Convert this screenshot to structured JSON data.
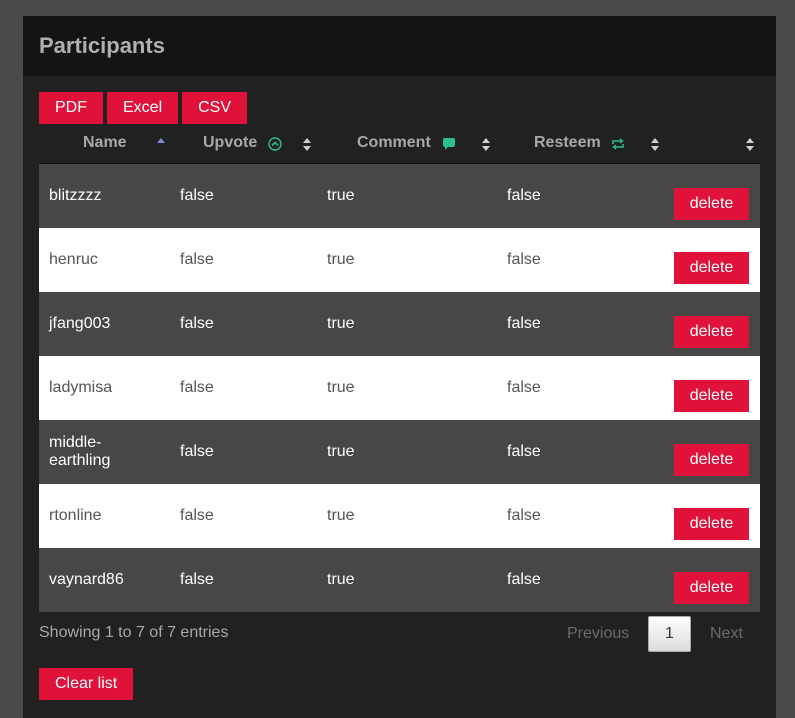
{
  "panel": {
    "title": "Participants"
  },
  "exports": [
    {
      "label": "PDF"
    },
    {
      "label": "Excel"
    },
    {
      "label": "CSV"
    }
  ],
  "columns": {
    "name": "Name",
    "upvote": "Upvote",
    "comment": "Comment",
    "resteem": "Resteem"
  },
  "icons": {
    "upvote": "upvote-circle-icon",
    "comment": "comment-bubble-icon",
    "resteem": "resteem-arrows-icon",
    "accent": "#2bbf8e"
  },
  "rows": [
    {
      "name": "blitzzzz",
      "upvote": "false",
      "comment": "true",
      "resteem": "false",
      "action": "delete"
    },
    {
      "name": "henruc",
      "upvote": "false",
      "comment": "true",
      "resteem": "false",
      "action": "delete"
    },
    {
      "name": "jfang003",
      "upvote": "false",
      "comment": "true",
      "resteem": "false",
      "action": "delete"
    },
    {
      "name": "ladymisa",
      "upvote": "false",
      "comment": "true",
      "resteem": "false",
      "action": "delete"
    },
    {
      "name": "middle-earthling",
      "upvote": "false",
      "comment": "true",
      "resteem": "false",
      "action": "delete"
    },
    {
      "name": "rtonline",
      "upvote": "false",
      "comment": "true",
      "resteem": "false",
      "action": "delete"
    },
    {
      "name": "vaynard86",
      "upvote": "false",
      "comment": "true",
      "resteem": "false",
      "action": "delete"
    }
  ],
  "footer": {
    "info": "Showing 1 to 7 of 7 entries",
    "previous": "Previous",
    "current_page": "1",
    "next": "Next"
  },
  "clear_label": "Clear list",
  "colors": {
    "accent": "#e0123a",
    "row_dark": "#474747",
    "row_light": "#ffffff"
  }
}
